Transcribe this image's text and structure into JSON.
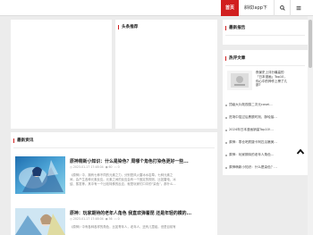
{
  "nav": {
    "home": "首页",
    "app": "斜纹Iapp下载"
  },
  "main": {
    "headline_section": "头条推荐",
    "latest_section": "最新资讯",
    "articles": [
      {
        "title": "原神萌新小知识：什么是染色？周哪个角色打染色更好一些...",
        "date": "2023-01-17 17:48:04",
        "views": "60",
        "comments": "0",
        "excerpt1": "《原神》中，拥有七种不同的元素之力，分别是风火雷冰水岩草。七种元素之",
        "excerpt2": "间，会产生各种元素反应。元素之间的反应会有一个固定的规则，比如雷电、冰",
        "excerpt3": "结、蒸发等。其中有一个比较特殊的反应，就是玩家们口中的“染色”。那什么..."
      },
      {
        "title": "原神：玩家期待的老年人角色 我直欢弹着琵 还是年轻的模的...",
        "date": "2023-01-17 17:48:04",
        "views": "36",
        "comments": "0",
        "excerpt1": "《原神》中有各种各样的角色，比如青年人，老年人，还有儿童组。但是目前有",
        "excerpt2": "",
        "excerpt3": ""
      }
    ]
  },
  "sidebar": {
    "notice_section": "最新报告",
    "hot_section": "热评文章",
    "featured_title_line1": "夜景史上评分最高的",
    "featured_title_line2": "「日本漫画」Top10，",
    "featured_title_line3": "你心中的神作上榜了几",
    "featured_title_line4": "部?",
    "hot_items": [
      "顶级大片既视感二次元cosei...",
      "进场中招过后黑额时刻，脉轮接...",
      "2024年日本漫画销量Top10!...",
      "原神：零仓吧质疑卡阿匹瓜嫩美...",
      "原神：玩家期待的老年人角色...",
      "原神萌新小知识：什么是染色？..."
    ]
  },
  "colors": {
    "accent": "#d11f1f"
  }
}
